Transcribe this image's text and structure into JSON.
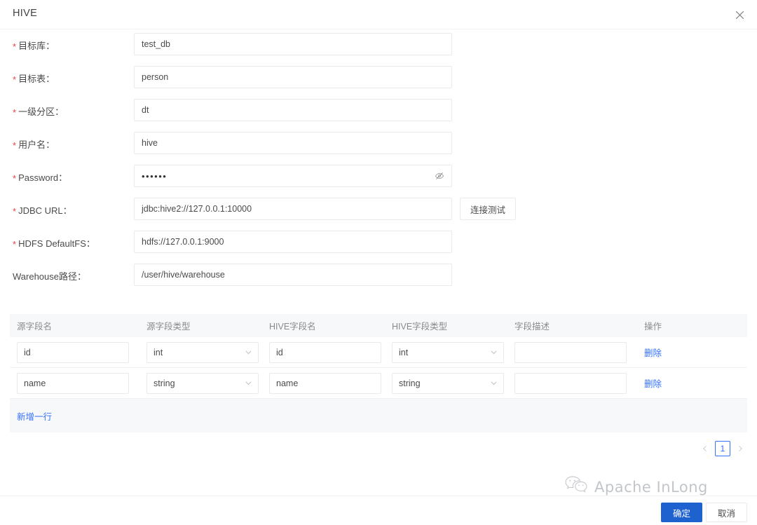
{
  "dialog": {
    "title": "HIVE",
    "close_icon": "close-icon"
  },
  "form": {
    "fields": [
      {
        "label": "目标库：",
        "required": true,
        "value": "test_db",
        "type": "text"
      },
      {
        "label": "目标表：",
        "required": true,
        "value": "person",
        "type": "text"
      },
      {
        "label": "一级分区：",
        "required": true,
        "value": "dt",
        "type": "text"
      },
      {
        "label": "用户名：",
        "required": true,
        "value": "hive",
        "type": "text"
      },
      {
        "label": "Password：",
        "required": true,
        "value": "••••••",
        "type": "password"
      },
      {
        "label": "JDBC URL：",
        "required": true,
        "value": "jdbc:hive2://127.0.0.1:10000",
        "type": "text"
      },
      {
        "label": "HDFS DefaultFS：",
        "required": true,
        "value": "hdfs://127.0.0.1:9000",
        "type": "text"
      },
      {
        "label": "Warehouse路径：",
        "required": false,
        "value": "/user/hive/warehouse",
        "type": "text"
      }
    ],
    "test_connection_label": "连接测试"
  },
  "table": {
    "headers": [
      "源字段名",
      "源字段类型",
      "HIVE字段名",
      "HIVE字段类型",
      "字段描述",
      "操作"
    ],
    "rows": [
      {
        "source_name": "id",
        "source_type": "int",
        "hive_name": "id",
        "hive_type": "int",
        "description": "",
        "action_label": "删除"
      },
      {
        "source_name": "name",
        "source_type": "string",
        "hive_name": "name",
        "hive_type": "string",
        "description": "",
        "action_label": "删除"
      }
    ],
    "add_row_label": "新增一行"
  },
  "pagination": {
    "prev_icon": "chevron-left-icon",
    "next_icon": "chevron-right-icon",
    "current_page": "1"
  },
  "watermark": {
    "text": "Apache InLong",
    "icon": "wechat-icon"
  },
  "footer": {
    "confirm_label": "确定",
    "cancel_label": "取消"
  },
  "colors": {
    "primary": "#1e62d0",
    "link": "#3370ff",
    "required": "#e54545",
    "border": "#e8eaec",
    "header_bg": "#f7f8fa"
  }
}
